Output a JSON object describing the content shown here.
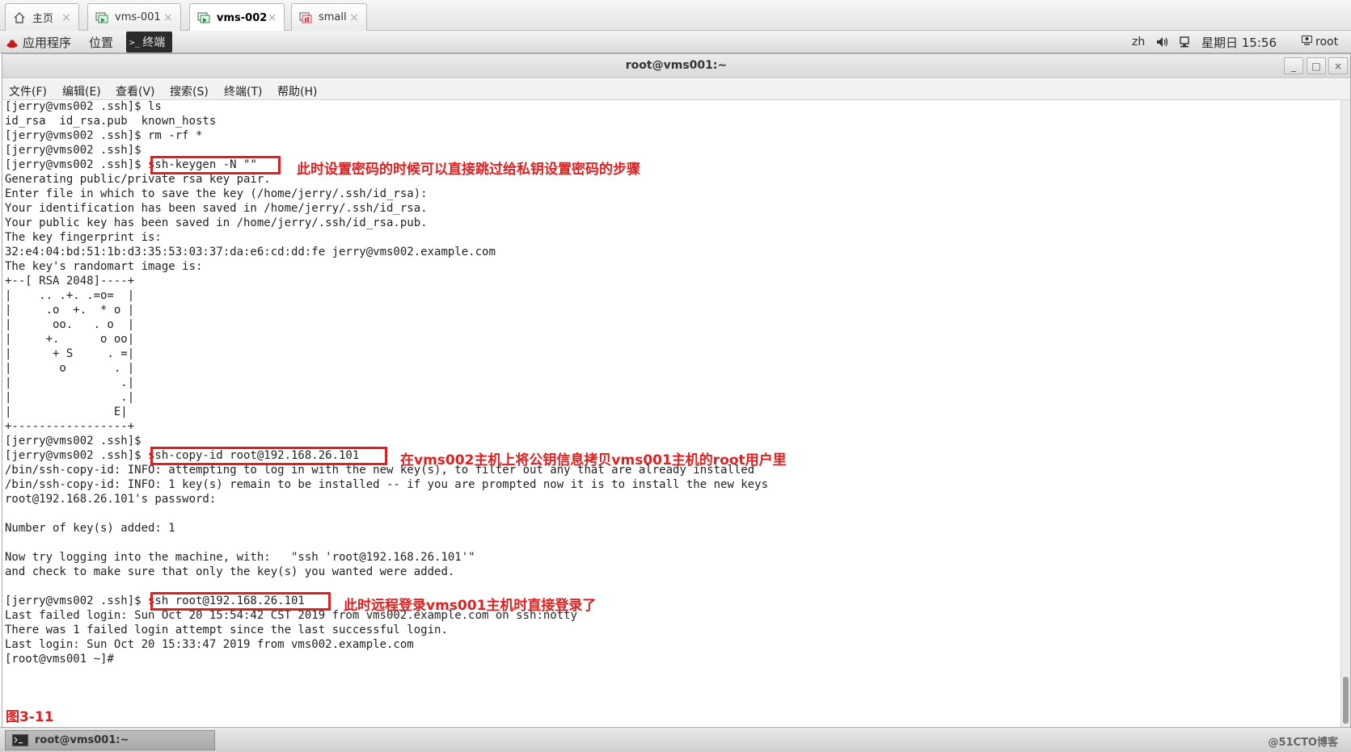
{
  "vm_tabs": [
    {
      "label": "主页",
      "icon": "home-icon",
      "active": false
    },
    {
      "label": "vms-001",
      "icon": "vm-icon",
      "active": false
    },
    {
      "label": "vms-002",
      "icon": "vm-icon",
      "active": true
    },
    {
      "label": "small",
      "icon": "vm-icon",
      "active": false
    }
  ],
  "topbar": {
    "apps": "应用程序",
    "places": "位置",
    "terminal": "终端",
    "lang": "zh",
    "datetime": "星期日 15:56",
    "user": "root"
  },
  "window": {
    "title": "root@vms001:~",
    "minimize": "_",
    "maximize": "□",
    "close": "×"
  },
  "menu": [
    "文件(F)",
    "编辑(E)",
    "查看(V)",
    "搜索(S)",
    "终端(T)",
    "帮助(H)"
  ],
  "terminal_lines": [
    "[jerry@vms002 .ssh]$ ls",
    "id_rsa  id_rsa.pub  known_hosts",
    "[jerry@vms002 .ssh]$ rm -rf *",
    "[jerry@vms002 .ssh]$",
    "[jerry@vms002 .ssh]$ ssh-keygen -N \"\"",
    "Generating public/private rsa key pair.",
    "Enter file in which to save the key (/home/jerry/.ssh/id_rsa):",
    "Your identification has been saved in /home/jerry/.ssh/id_rsa.",
    "Your public key has been saved in /home/jerry/.ssh/id_rsa.pub.",
    "The key fingerprint is:",
    "32:e4:04:bd:51:1b:d3:35:53:03:37:da:e6:cd:dd:fe jerry@vms002.example.com",
    "The key's randomart image is:",
    "+--[ RSA 2048]----+",
    "|    .. .+. .=o=  |",
    "|     .o  +.  * o |",
    "|      oo.   . o  |",
    "|     +.      o oo|",
    "|      + S     . =|",
    "|       o       . |",
    "|                .|",
    "|                .|",
    "|               E|",
    "+-----------------+",
    "[jerry@vms002 .ssh]$",
    "[jerry@vms002 .ssh]$ ssh-copy-id root@192.168.26.101",
    "/bin/ssh-copy-id: INFO: attempting to log in with the new key(s), to filter out any that are already installed",
    "/bin/ssh-copy-id: INFO: 1 key(s) remain to be installed -- if you are prompted now it is to install the new keys",
    "root@192.168.26.101's password:",
    "",
    "Number of key(s) added: 1",
    "",
    "Now try logging into the machine, with:   \"ssh 'root@192.168.26.101'\"",
    "and check to make sure that only the key(s) you wanted were added.",
    "",
    "[jerry@vms002 .ssh]$ ssh root@192.168.26.101",
    "Last failed login: Sun Oct 20 15:54:42 CST 2019 from vms002.example.com on ssh:notty",
    "There was 1 failed login attempt since the last successful login.",
    "Last login: Sun Oct 20 15:33:47 2019 from vms002.example.com",
    "[root@vms001 ~]#"
  ],
  "annotations": [
    "此时设置密码的时候可以直接跳过给私钥设置密码的步骤",
    "在vms002主机上将公钥信息拷贝vms001主机的root用户里",
    "此时远程登录vms001主机时直接登录了"
  ],
  "figure_label": "图3-11",
  "taskbar": {
    "task": "root@vms001:~"
  },
  "watermark": "@51CTO博客",
  "colors": {
    "annotation": "#e02020",
    "terminal_bg": "#ffffff"
  }
}
